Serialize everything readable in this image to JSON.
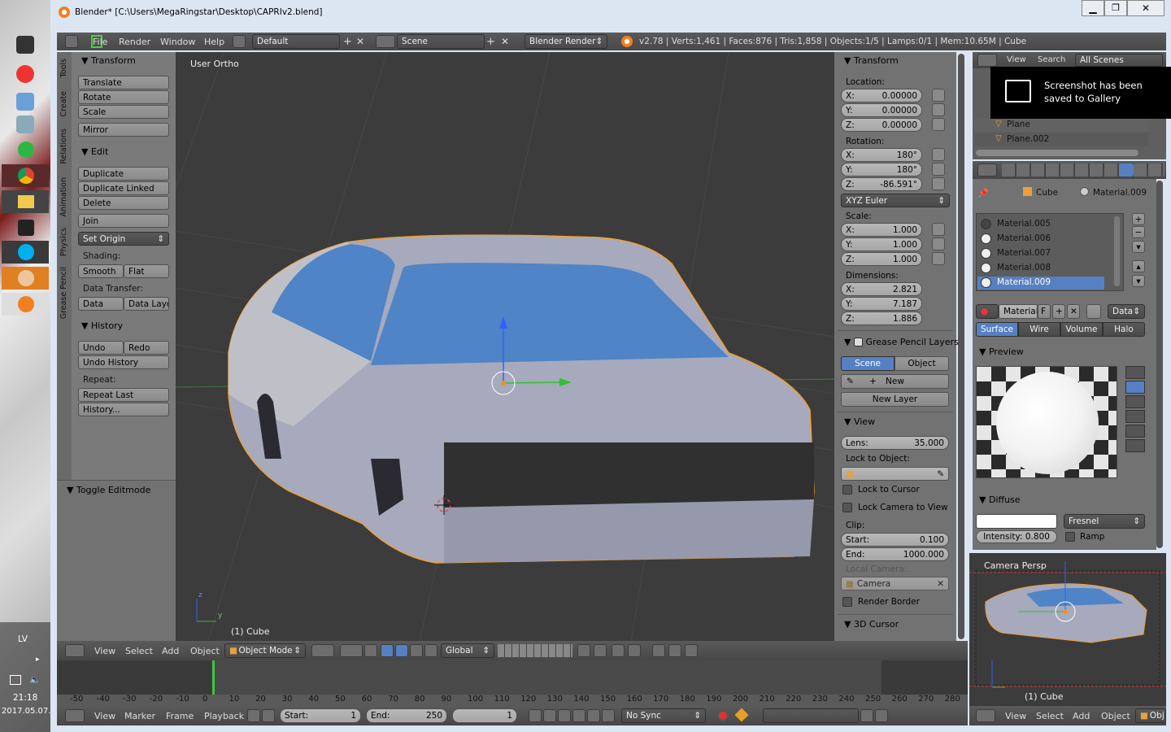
{
  "window": {
    "title": "Blender* [C:\\Users\\MegaRingstar\\Desktop\\CAPRIv2.blend]"
  },
  "menubar": {
    "file": "File",
    "render": "Render",
    "window": "Window",
    "help": "Help",
    "layout": "Default",
    "scene": "Scene",
    "engine": "Blender Render",
    "stats": "v2.78 | Verts:1,461 | Faces:876 | Tris:1,858 | Objects:1/5 | Lamps:0/1 | Mem:10.65M | Cube"
  },
  "toolshelf": {
    "tabs": [
      "Tools",
      "Create",
      "Relations",
      "Animation",
      "Physics",
      "Grease Pencil"
    ],
    "transform_header": "Transform",
    "translate": "Translate",
    "rotate": "Rotate",
    "scale": "Scale",
    "mirror": "Mirror",
    "edit_header": "Edit",
    "duplicate": "Duplicate",
    "duplicate_linked": "Duplicate Linked",
    "delete": "Delete",
    "join": "Join",
    "set_origin": "Set Origin",
    "shading_label": "Shading:",
    "smooth": "Smooth",
    "flat": "Flat",
    "data_transfer_label": "Data Transfer:",
    "data": "Data",
    "data_layo": "Data Layo",
    "history_header": "History",
    "undo": "Undo",
    "redo": "Redo",
    "undo_history": "Undo History",
    "repeat_label": "Repeat:",
    "repeat_last": "Repeat Last",
    "history_btn": "History...",
    "toggle_editmode": "Toggle Editmode"
  },
  "viewport": {
    "view_label": "User Ortho",
    "object_label": "(1) Cube",
    "axis_z": "z",
    "axis_y": "y"
  },
  "viewport_header": {
    "view": "View",
    "select": "Select",
    "add": "Add",
    "object": "Object",
    "mode": "Object Mode",
    "orientation": "Global"
  },
  "npanel": {
    "transform_header": "Transform",
    "location_label": "Location:",
    "loc": [
      {
        "axis": "X:",
        "value": "0.00000"
      },
      {
        "axis": "Y:",
        "value": "0.00000"
      },
      {
        "axis": "Z:",
        "value": "0.00000"
      }
    ],
    "rotation_label": "Rotation:",
    "rot": [
      {
        "axis": "X:",
        "value": "180°"
      },
      {
        "axis": "Y:",
        "value": "180°"
      },
      {
        "axis": "Z:",
        "value": "-86.591°"
      }
    ],
    "rotation_mode": "XYZ Euler",
    "scale_label": "Scale:",
    "scl": [
      {
        "axis": "X:",
        "value": "1.000"
      },
      {
        "axis": "Y:",
        "value": "1.000"
      },
      {
        "axis": "Z:",
        "value": "1.000"
      }
    ],
    "dimensions_label": "Dimensions:",
    "dim": [
      {
        "axis": "X:",
        "value": "2.821"
      },
      {
        "axis": "Y:",
        "value": "7.187"
      },
      {
        "axis": "Z:",
        "value": "1.886"
      }
    ],
    "grease_header": "Grease Pencil Layers",
    "scene_tab": "Scene",
    "object_tab": "Object",
    "new": "New",
    "new_layer": "New Layer",
    "view_header": "View",
    "lens_label": "Lens:",
    "lens_value": "35.000",
    "lock_object_label": "Lock to Object:",
    "lock_cursor": "Lock to Cursor",
    "lock_camera": "Lock Camera to View",
    "clip_label": "Clip:",
    "clip_start_label": "Start:",
    "clip_start_value": "0.100",
    "clip_end_label": "End:",
    "clip_end_value": "1000.000",
    "local_camera_label": "Local Camera:",
    "camera": "Camera",
    "render_border": "Render Border",
    "cursor_header": "3D Cursor"
  },
  "outliner": {
    "view": "View",
    "search": "Search",
    "all_scenes": "All Scenes",
    "items": [
      "Plane",
      "Plane.002"
    ]
  },
  "toast": {
    "text": "Screenshot has been saved to Gallery"
  },
  "properties": {
    "crumb_cube": "Cube",
    "crumb_material": "Material.009",
    "materials": [
      "Material.005",
      "Material.006",
      "Material.007",
      "Material.008",
      "Material.009"
    ],
    "material_field": "Material.",
    "f": "F",
    "data": "Data",
    "tabs": [
      "Surface",
      "Wire",
      "Volume",
      "Halo"
    ],
    "preview_header": "Preview",
    "diffuse_header": "Diffuse",
    "fresnel": "Fresnel",
    "intensity": "Intensity: 0.800",
    "ramp": "Ramp"
  },
  "camera_view": {
    "label": "Camera Persp",
    "object_label": "(1) Cube"
  },
  "timeline": {
    "ticks": [
      "-50",
      "-40",
      "-30",
      "-20",
      "-10",
      "0",
      "10",
      "20",
      "30",
      "40",
      "50",
      "60",
      "70",
      "80",
      "90",
      "100",
      "110",
      "120",
      "130",
      "140",
      "150",
      "160",
      "170",
      "180",
      "190",
      "200",
      "210",
      "220",
      "230",
      "240",
      "250",
      "260",
      "270",
      "280"
    ]
  },
  "timeline_header": {
    "view": "View",
    "marker": "Marker",
    "frame": "Frame",
    "playback": "Playback",
    "start_label": "Start:",
    "start_value": "1",
    "end_label": "End:",
    "end_value": "250",
    "current": "1",
    "sync": "No Sync"
  },
  "right_bottom_header": {
    "view": "View",
    "select": "Select",
    "add": "Add",
    "object": "Object",
    "obj": "Obj"
  },
  "taskbar": {
    "lang": "LV",
    "time": "21:18",
    "date": "2017.05.07."
  },
  "colors": {
    "accent": "#5680c2",
    "background": "#3d3d3d",
    "selection": "#f0a030",
    "window_chrome": "#dce6f2"
  }
}
